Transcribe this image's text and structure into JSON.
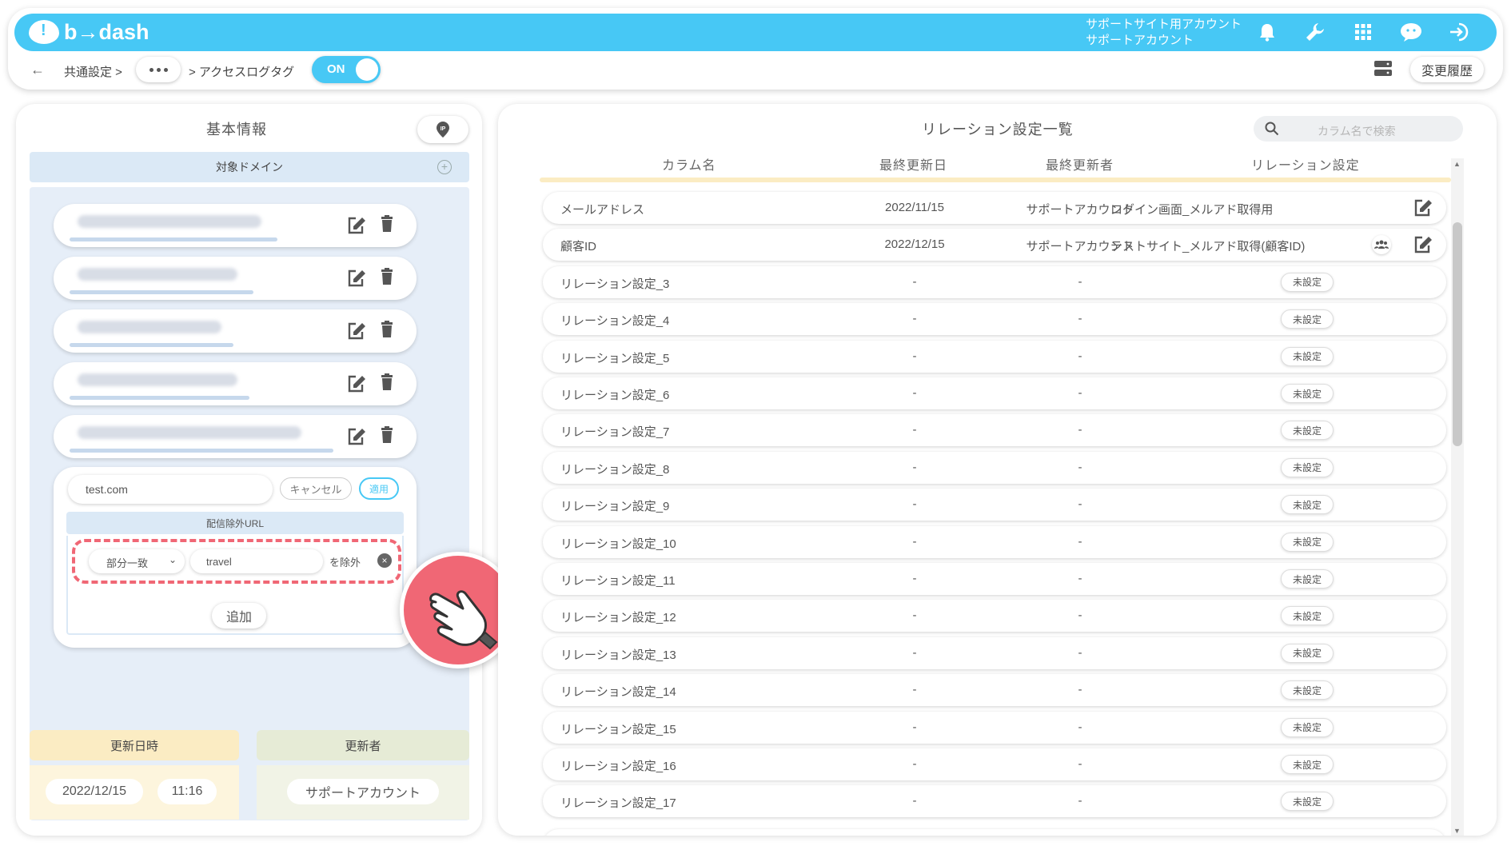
{
  "header": {
    "brand": "b→dash",
    "account_line1": "サポートサイト用アカウント",
    "account_line2": "サポートアカウント",
    "icons": [
      "bell-icon",
      "wrench-icon",
      "grid-icon",
      "support-icon",
      "logout-icon"
    ]
  },
  "breadcrumb": {
    "back": "←",
    "item1": "共通設定 >",
    "item2": "> アクセスログタグ",
    "toggle_label": "ON",
    "history_button": "変更履歴"
  },
  "left": {
    "title": "基本情報",
    "ip_icon": "ip-pin-icon",
    "domain_header": "対象ドメイン",
    "edit": {
      "domain_value": "test.com",
      "cancel": "キャンセル",
      "apply": "適用",
      "exclude_header": "配信除外URL",
      "match_type": "部分一致",
      "url_value": "travel",
      "exclude_suffix": "を除外",
      "add": "追加"
    },
    "updated_at_label": "更新日時",
    "updated_date": "2022/12/15",
    "updated_time": "11:16",
    "updated_by_label": "更新者",
    "updated_by": "サポートアカウント"
  },
  "right": {
    "title": "リレーション設定一覧",
    "search_placeholder": "カラム名で検索",
    "columns": {
      "name": "カラム名",
      "date": "最終更新日",
      "user": "最終更新者",
      "relation": "リレーション設定"
    },
    "rows": [
      {
        "name": "メールアドレス",
        "date": "2022/11/15",
        "user": "サポートアカウント",
        "relation": "ログイン画面_メルアド取得用"
      },
      {
        "name": "顧客ID",
        "date": "2022/12/15",
        "user": "サポートアカウント",
        "relation": "テストサイト_メルアド取得(顧客ID)"
      },
      {
        "name": "リレーション設定_3",
        "date": "-",
        "user": "-",
        "relation": "未設定"
      },
      {
        "name": "リレーション設定_4",
        "date": "-",
        "user": "-",
        "relation": "未設定"
      },
      {
        "name": "リレーション設定_5",
        "date": "-",
        "user": "-",
        "relation": "未設定"
      },
      {
        "name": "リレーション設定_6",
        "date": "-",
        "user": "-",
        "relation": "未設定"
      },
      {
        "name": "リレーション設定_7",
        "date": "-",
        "user": "-",
        "relation": "未設定"
      },
      {
        "name": "リレーション設定_8",
        "date": "-",
        "user": "-",
        "relation": "未設定"
      },
      {
        "name": "リレーション設定_9",
        "date": "-",
        "user": "-",
        "relation": "未設定"
      },
      {
        "name": "リレーション設定_10",
        "date": "-",
        "user": "-",
        "relation": "未設定"
      },
      {
        "name": "リレーション設定_11",
        "date": "-",
        "user": "-",
        "relation": "未設定"
      },
      {
        "name": "リレーション設定_12",
        "date": "-",
        "user": "-",
        "relation": "未設定"
      },
      {
        "name": "リレーション設定_13",
        "date": "-",
        "user": "-",
        "relation": "未設定"
      },
      {
        "name": "リレーション設定_14",
        "date": "-",
        "user": "-",
        "relation": "未設定"
      },
      {
        "name": "リレーション設定_15",
        "date": "-",
        "user": "-",
        "relation": "未設定"
      },
      {
        "name": "リレーション設定_16",
        "date": "-",
        "user": "-",
        "relation": "未設定"
      },
      {
        "name": "リレーション設定_17",
        "date": "-",
        "user": "-",
        "relation": "未設定"
      }
    ]
  },
  "colors": {
    "brand": "#47c8f5",
    "highlight": "#f06775",
    "panel_blue": "#dbe9f6",
    "accent_yellow": "#fbecc3"
  }
}
